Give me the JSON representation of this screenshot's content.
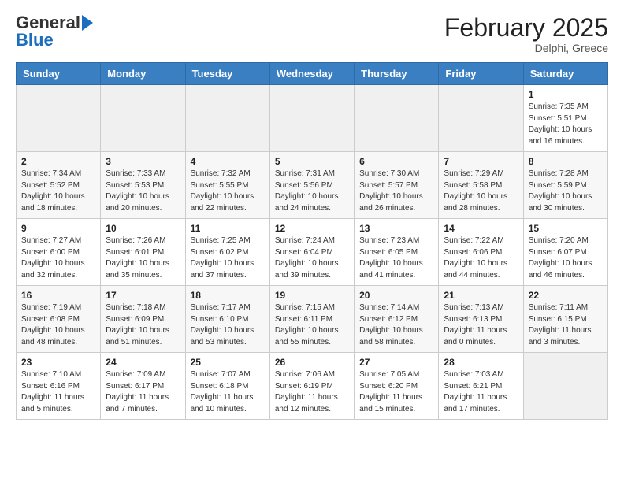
{
  "header": {
    "logo_general": "General",
    "logo_blue": "Blue",
    "main_title": "February 2025",
    "subtitle": "Delphi, Greece"
  },
  "calendar": {
    "days_of_week": [
      "Sunday",
      "Monday",
      "Tuesday",
      "Wednesday",
      "Thursday",
      "Friday",
      "Saturday"
    ],
    "weeks": [
      [
        {
          "day": "",
          "info": ""
        },
        {
          "day": "",
          "info": ""
        },
        {
          "day": "",
          "info": ""
        },
        {
          "day": "",
          "info": ""
        },
        {
          "day": "",
          "info": ""
        },
        {
          "day": "",
          "info": ""
        },
        {
          "day": "1",
          "info": "Sunrise: 7:35 AM\nSunset: 5:51 PM\nDaylight: 10 hours\nand 16 minutes."
        }
      ],
      [
        {
          "day": "2",
          "info": "Sunrise: 7:34 AM\nSunset: 5:52 PM\nDaylight: 10 hours\nand 18 minutes."
        },
        {
          "day": "3",
          "info": "Sunrise: 7:33 AM\nSunset: 5:53 PM\nDaylight: 10 hours\nand 20 minutes."
        },
        {
          "day": "4",
          "info": "Sunrise: 7:32 AM\nSunset: 5:55 PM\nDaylight: 10 hours\nand 22 minutes."
        },
        {
          "day": "5",
          "info": "Sunrise: 7:31 AM\nSunset: 5:56 PM\nDaylight: 10 hours\nand 24 minutes."
        },
        {
          "day": "6",
          "info": "Sunrise: 7:30 AM\nSunset: 5:57 PM\nDaylight: 10 hours\nand 26 minutes."
        },
        {
          "day": "7",
          "info": "Sunrise: 7:29 AM\nSunset: 5:58 PM\nDaylight: 10 hours\nand 28 minutes."
        },
        {
          "day": "8",
          "info": "Sunrise: 7:28 AM\nSunset: 5:59 PM\nDaylight: 10 hours\nand 30 minutes."
        }
      ],
      [
        {
          "day": "9",
          "info": "Sunrise: 7:27 AM\nSunset: 6:00 PM\nDaylight: 10 hours\nand 32 minutes."
        },
        {
          "day": "10",
          "info": "Sunrise: 7:26 AM\nSunset: 6:01 PM\nDaylight: 10 hours\nand 35 minutes."
        },
        {
          "day": "11",
          "info": "Sunrise: 7:25 AM\nSunset: 6:02 PM\nDaylight: 10 hours\nand 37 minutes."
        },
        {
          "day": "12",
          "info": "Sunrise: 7:24 AM\nSunset: 6:04 PM\nDaylight: 10 hours\nand 39 minutes."
        },
        {
          "day": "13",
          "info": "Sunrise: 7:23 AM\nSunset: 6:05 PM\nDaylight: 10 hours\nand 41 minutes."
        },
        {
          "day": "14",
          "info": "Sunrise: 7:22 AM\nSunset: 6:06 PM\nDaylight: 10 hours\nand 44 minutes."
        },
        {
          "day": "15",
          "info": "Sunrise: 7:20 AM\nSunset: 6:07 PM\nDaylight: 10 hours\nand 46 minutes."
        }
      ],
      [
        {
          "day": "16",
          "info": "Sunrise: 7:19 AM\nSunset: 6:08 PM\nDaylight: 10 hours\nand 48 minutes."
        },
        {
          "day": "17",
          "info": "Sunrise: 7:18 AM\nSunset: 6:09 PM\nDaylight: 10 hours\nand 51 minutes."
        },
        {
          "day": "18",
          "info": "Sunrise: 7:17 AM\nSunset: 6:10 PM\nDaylight: 10 hours\nand 53 minutes."
        },
        {
          "day": "19",
          "info": "Sunrise: 7:15 AM\nSunset: 6:11 PM\nDaylight: 10 hours\nand 55 minutes."
        },
        {
          "day": "20",
          "info": "Sunrise: 7:14 AM\nSunset: 6:12 PM\nDaylight: 10 hours\nand 58 minutes."
        },
        {
          "day": "21",
          "info": "Sunrise: 7:13 AM\nSunset: 6:13 PM\nDaylight: 11 hours\nand 0 minutes."
        },
        {
          "day": "22",
          "info": "Sunrise: 7:11 AM\nSunset: 6:15 PM\nDaylight: 11 hours\nand 3 minutes."
        }
      ],
      [
        {
          "day": "23",
          "info": "Sunrise: 7:10 AM\nSunset: 6:16 PM\nDaylight: 11 hours\nand 5 minutes."
        },
        {
          "day": "24",
          "info": "Sunrise: 7:09 AM\nSunset: 6:17 PM\nDaylight: 11 hours\nand 7 minutes."
        },
        {
          "day": "25",
          "info": "Sunrise: 7:07 AM\nSunset: 6:18 PM\nDaylight: 11 hours\nand 10 minutes."
        },
        {
          "day": "26",
          "info": "Sunrise: 7:06 AM\nSunset: 6:19 PM\nDaylight: 11 hours\nand 12 minutes."
        },
        {
          "day": "27",
          "info": "Sunrise: 7:05 AM\nSunset: 6:20 PM\nDaylight: 11 hours\nand 15 minutes."
        },
        {
          "day": "28",
          "info": "Sunrise: 7:03 AM\nSunset: 6:21 PM\nDaylight: 11 hours\nand 17 minutes."
        },
        {
          "day": "",
          "info": ""
        }
      ]
    ]
  }
}
